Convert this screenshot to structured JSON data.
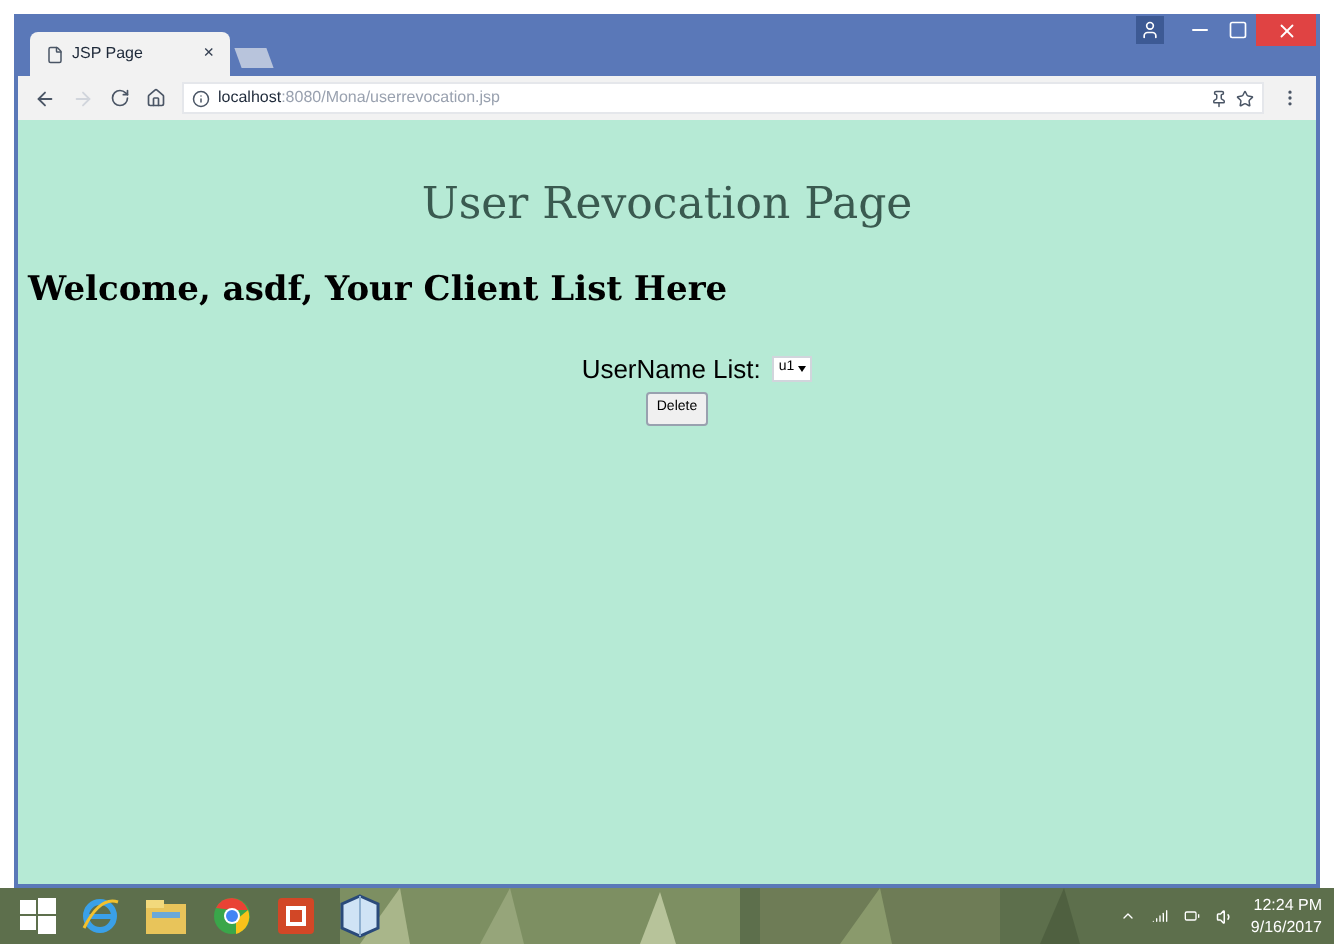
{
  "browser": {
    "tab": {
      "title": "JSP Page",
      "close": "×"
    },
    "address": {
      "host": "localhost",
      "path": ":8080/Mona/userrevocation.jsp"
    }
  },
  "page": {
    "title": "User Revocation Page",
    "welcome": "Welcome, asdf, Your Client List Here",
    "list_label": "UserName List:",
    "select_value": "u1",
    "button": "Delete"
  },
  "taskbar": {
    "time": "12:24 PM",
    "date": "9/16/2017"
  }
}
